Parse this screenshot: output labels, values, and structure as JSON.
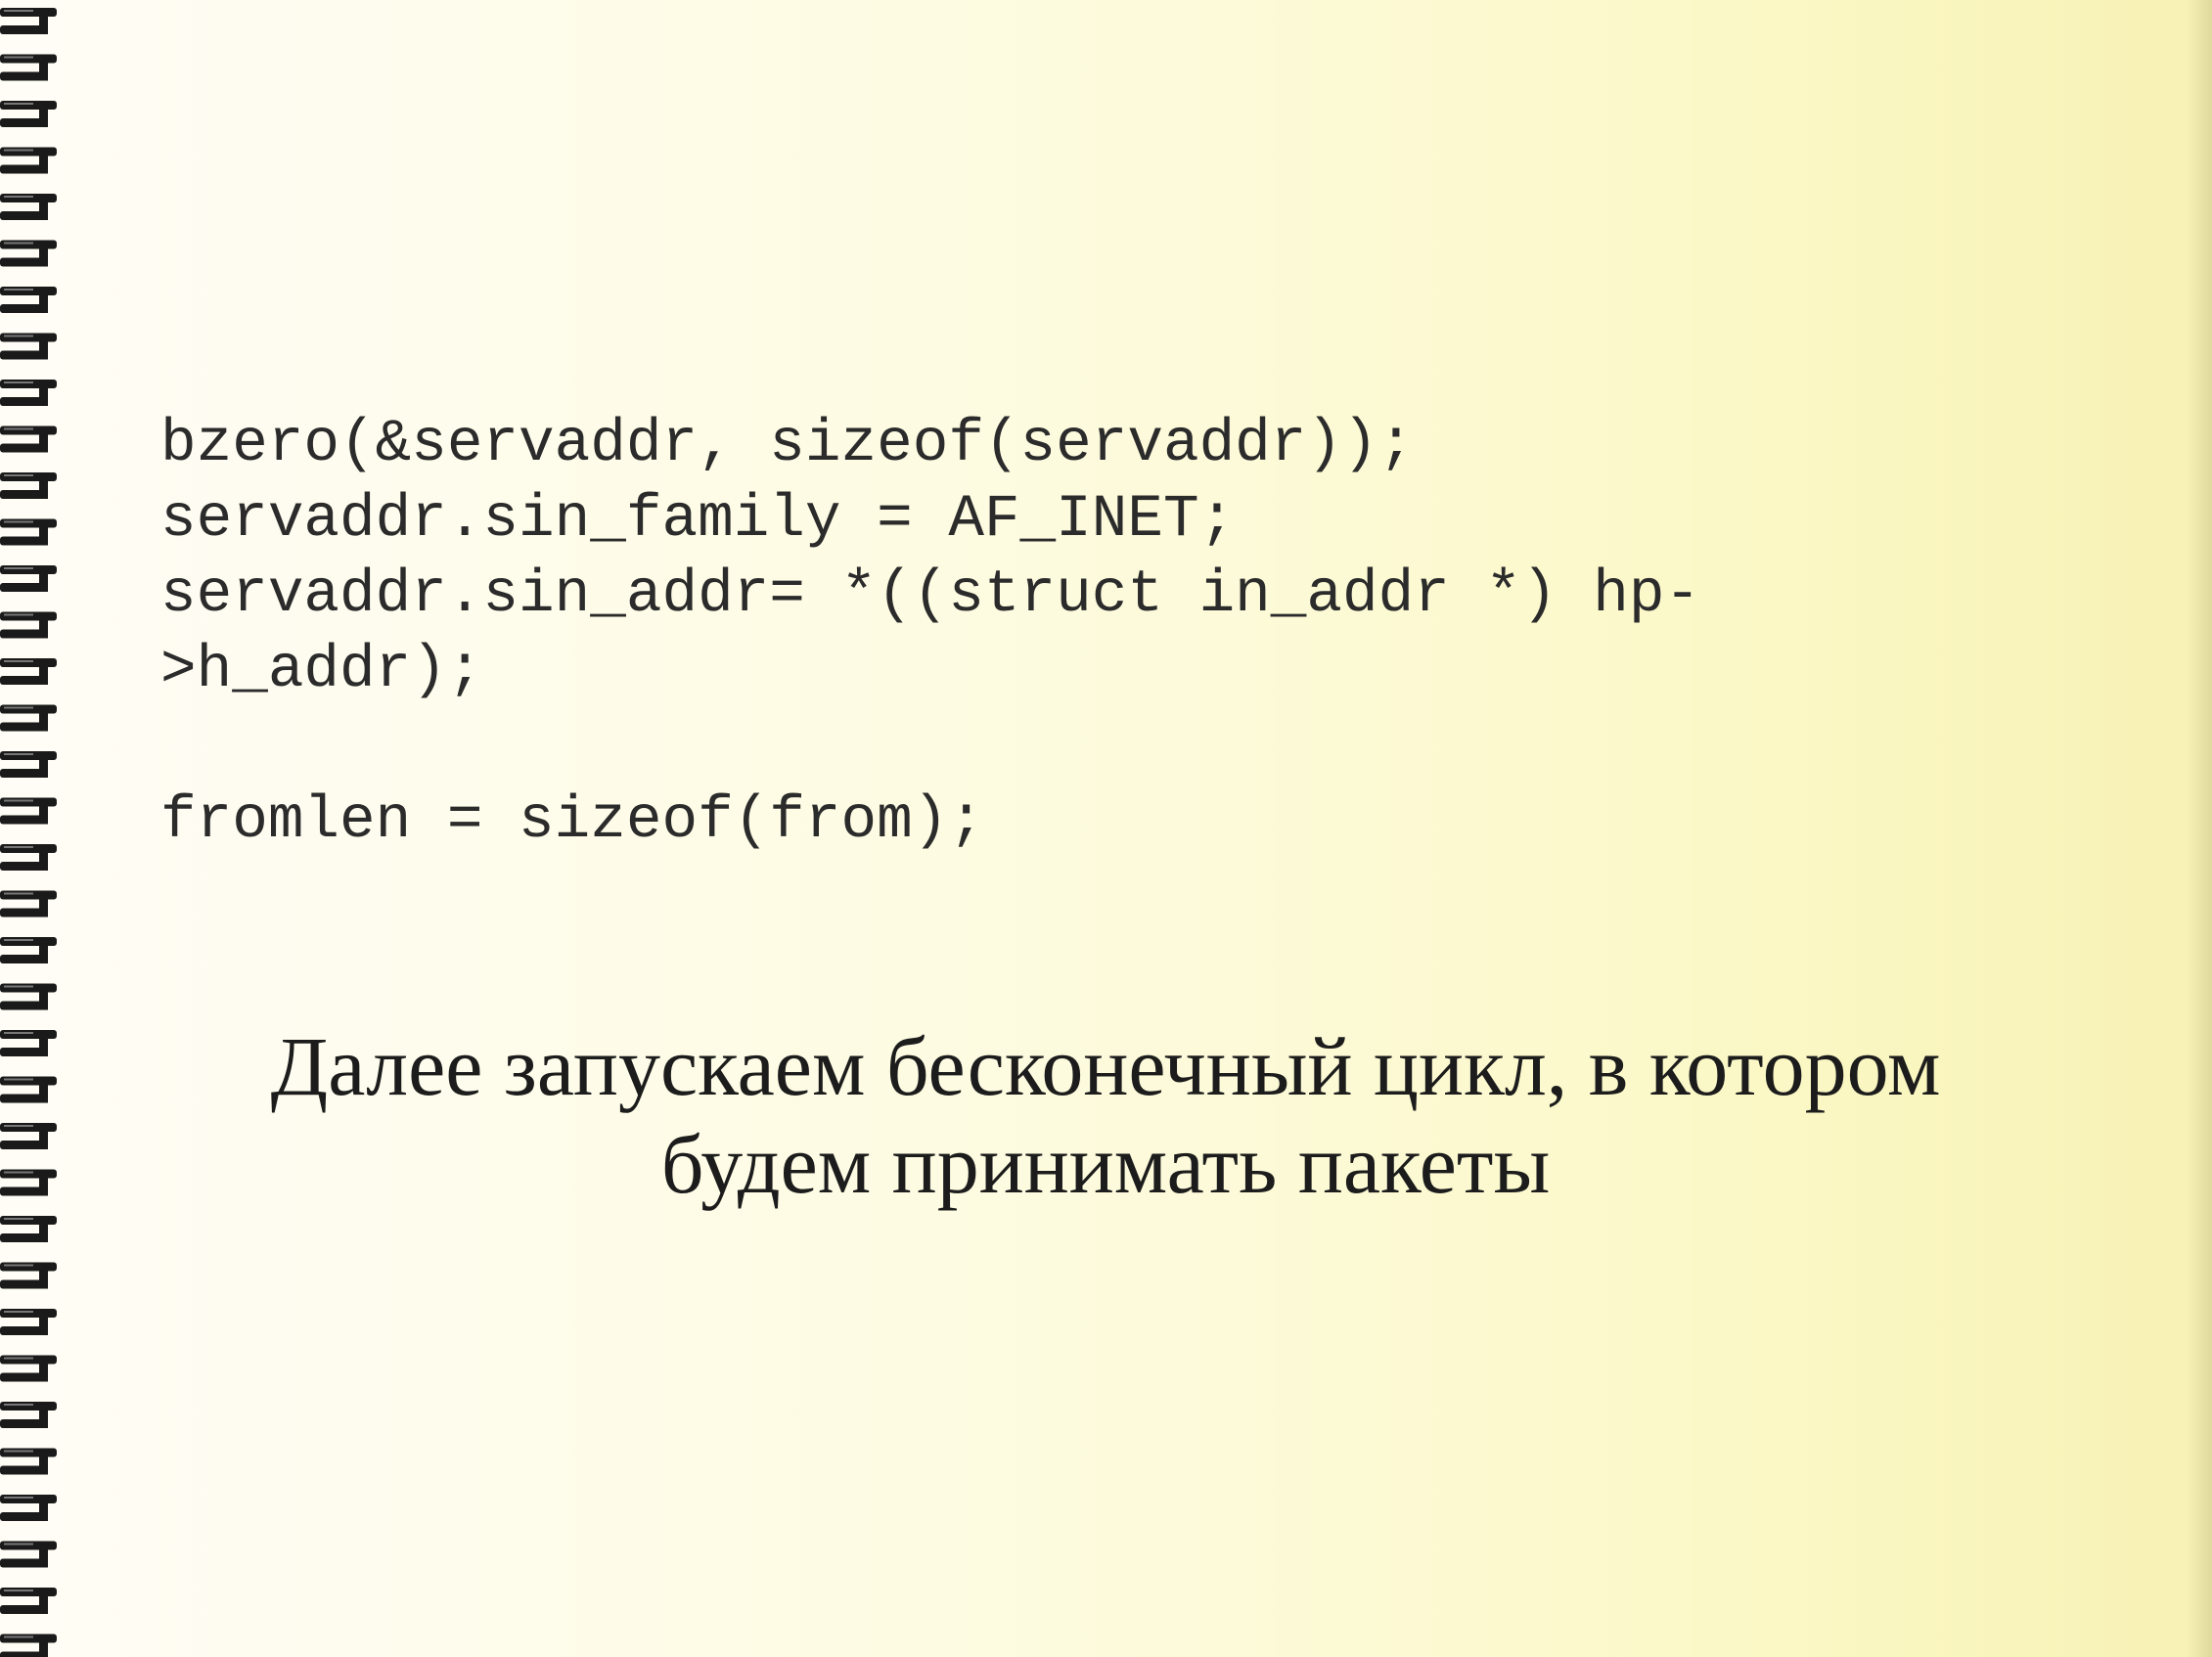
{
  "slide": {
    "code_lines": [
      "bzero(&servaddr, sizeof(servaddr));",
      "servaddr.sin_family = AF_INET;",
      "servaddr.sin_addr= *((struct in_addr *) hp-",
      ">h_addr);",
      "",
      "fromlen = sizeof(from);"
    ],
    "caption_lines": [
      "Далее запускаем бесконечный цикл, в котором",
      "будем принимать пакеты"
    ]
  },
  "colors": {
    "background_left": "#fffdf6",
    "background_right": "#f7f1b4",
    "text": "#1c1c1c",
    "binding": "#1a1a1a"
  },
  "icons": {
    "binding": "spiral-binding-icon"
  }
}
